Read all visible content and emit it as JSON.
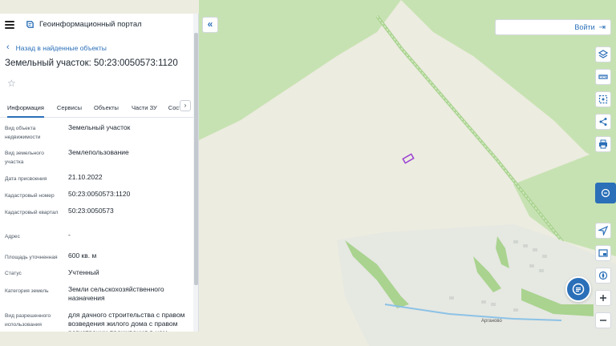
{
  "header": {
    "app_title": "Геоинформационный портал"
  },
  "nav": {
    "back_label": "Назад в найденные объекты"
  },
  "object": {
    "title": "Земельный участок: 50:23:0050573:1120"
  },
  "tabs": [
    {
      "label": "Информация",
      "active": true
    },
    {
      "label": "Сервисы"
    },
    {
      "label": "Объекты"
    },
    {
      "label": "Части ЗУ"
    },
    {
      "label": "Сост"
    }
  ],
  "properties": [
    {
      "label": "Вид объекта недвижимости",
      "value": "Земельный участок"
    },
    {
      "label": "Вид земельного участка",
      "value": "Землепользование"
    },
    {
      "label": "Дата присвоения",
      "value": "21.10.2022"
    },
    {
      "label": "Кадастровый номер",
      "value": "50:23:0050573:1120"
    },
    {
      "label": "Кадастровый квартал",
      "value": "50:23:0050573"
    },
    {
      "label": "Адрес",
      "value": "-"
    },
    {
      "label": "Площадь уточненная",
      "value": "600 кв. м"
    },
    {
      "label": "Статус",
      "value": "Учтенный"
    },
    {
      "label": "Категория земель",
      "value": "Земли сельскохозяйственного назначения"
    },
    {
      "label": "Вид разрешенного использования",
      "value": "для дачного строительства с правом возведения жилого дома с правом регистрации проживания в нем"
    }
  ],
  "login": {
    "label": "Войти"
  },
  "map": {
    "town_label": "Арганово"
  },
  "toolbar_icons": [
    "layers-icon",
    "ruler-icon",
    "select-area-icon",
    "share-icon",
    "print-icon",
    "chat-icon",
    "locate-icon",
    "minimap-icon",
    "compass-icon",
    "zoom-in-icon",
    "zoom-out-icon"
  ],
  "colors": {
    "accent": "#2a6fb8",
    "field": "#ecece0",
    "forest": "#c7e2b2",
    "road": "#a9d38f",
    "parcel": "#9b3fd4"
  }
}
